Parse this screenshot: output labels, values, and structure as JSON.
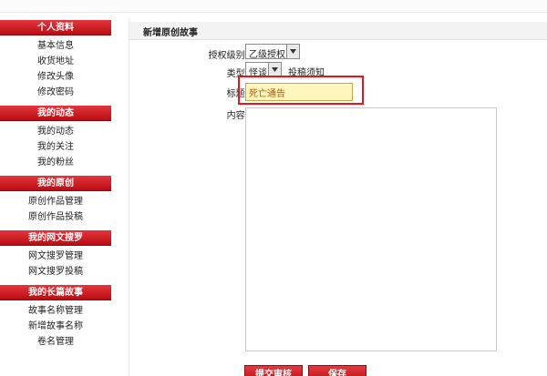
{
  "sidebar": {
    "sections": [
      {
        "title": "个人资料",
        "items": [
          "基本信息",
          "收货地址",
          "修改头像",
          "修改密码"
        ]
      },
      {
        "title": "我的动态",
        "items": [
          "我的动态",
          "我的关注",
          "我的粉丝"
        ]
      },
      {
        "title": "我的原创",
        "items": [
          "原创作品管理",
          "原创作品投稿"
        ]
      },
      {
        "title": "我的网文搜罗",
        "items": [
          "网文搜罗管理",
          "网文搜罗投稿"
        ]
      },
      {
        "title": "我的长篇故事",
        "items": [
          "故事名称管理",
          "新增故事名称",
          "卷名管理"
        ]
      }
    ]
  },
  "form": {
    "title": "新增原创故事",
    "grant_label": "授权级别:",
    "grant_value": "乙级授权",
    "type_label": "类型:",
    "type_value": "怪谈",
    "submit_link": "投稿须知",
    "title_label": "标题:",
    "title_value": "死亡通告",
    "content_label": "内容:",
    "submit_button": "提交审核",
    "save_button": "保存"
  }
}
